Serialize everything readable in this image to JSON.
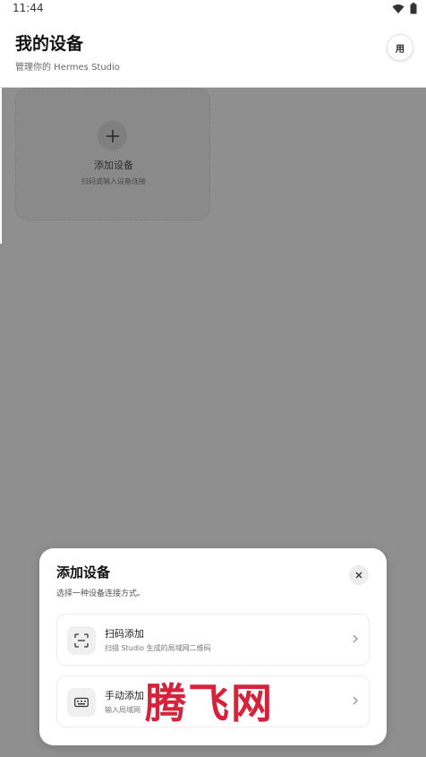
{
  "status_bar": {
    "time": "11:44",
    "wifi_icon": "wifi-icon",
    "battery_icon": "battery-icon"
  },
  "header": {
    "title": "我的设备",
    "subtitle": "管理你的 Hermes Studio",
    "user_button_label": "用"
  },
  "add_card": {
    "icon": "plus-icon",
    "title": "添加设备",
    "subtitle": "扫码或输入设备连接"
  },
  "sheet": {
    "title": "添加设备",
    "subtitle": "选择一种设备连接方式。",
    "close_icon": "close-icon",
    "options": [
      {
        "icon": "scan-icon",
        "label": "扫码添加",
        "description": "扫描 Studio 生成的局域网二维码"
      },
      {
        "icon": "keyboard-icon",
        "label": "手动添加",
        "description": "输入局域网"
      }
    ]
  },
  "watermark": "腾飞网",
  "colors": {
    "overlay": "#8f8f8f",
    "sheet_bg": "#ffffff",
    "watermark": "#d7223c"
  }
}
